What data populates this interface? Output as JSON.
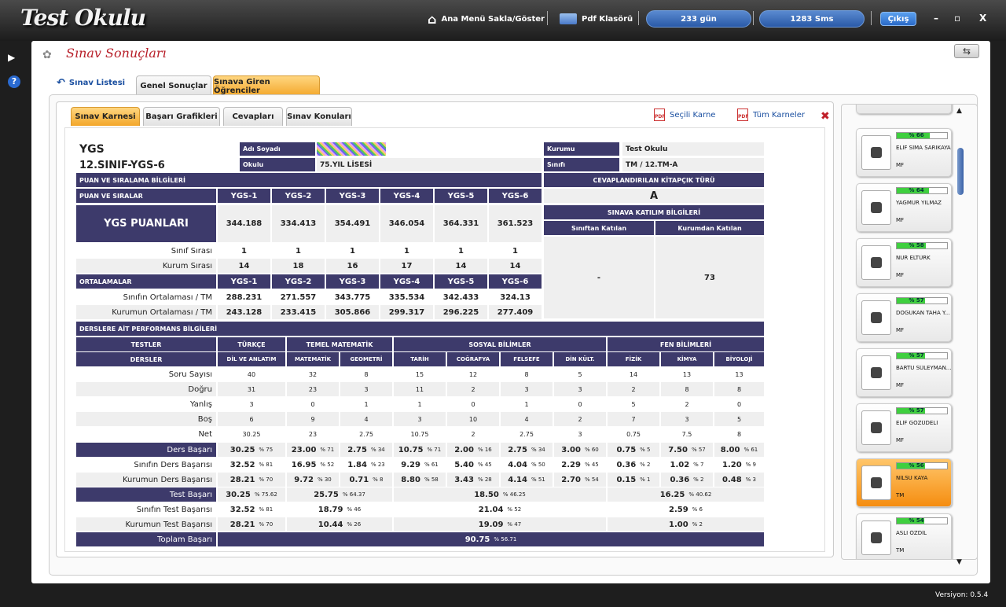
{
  "app": {
    "title": "Test Okulu",
    "menu_toggle": "Ana Menü Sakla/Göster",
    "pdf_folder": "Pdf Klasörü",
    "days": "233 gün",
    "sms": "1283 Sms",
    "logout": "Çıkış",
    "minimize": "–",
    "maximize": "▫",
    "close": "X",
    "version": "Versiyon: 0.5.4"
  },
  "page": {
    "title": "Sınav Sonuçları",
    "back": "Sınav Listesi",
    "tabs": [
      "Genel Sonuçlar",
      "Sınava Giren Öğrenciler"
    ],
    "subtabs": [
      "Sınav Karnesi",
      "Başarı Grafikleri",
      "Cevapları",
      "Sınav Konuları"
    ],
    "pdf_selected": "Seçili Karne",
    "pdf_all": "Tüm Karneler"
  },
  "report": {
    "exam": "YGS",
    "exam_code": "12.SINIF-YGS-6",
    "l_name": "Adı Soyadı",
    "l_school": "Okulu",
    "school": "75.YIL LİSESİ",
    "l_inst": "Kurumu",
    "inst": "Test Okulu",
    "l_class": "Sınıfı",
    "cls": "TM / 12.TM-A",
    "sec_scores": "PUAN VE SIRALAMA BİLGİLERİ",
    "sec_booklet": "CEVAPLANDIRILAN KİTAPÇIK TÜRÜ",
    "booklet": "A",
    "l_scores": "PUAN VE SIRALAR",
    "ygs_cols": [
      "YGS-1",
      "YGS-2",
      "YGS-3",
      "YGS-4",
      "YGS-5",
      "YGS-6"
    ],
    "l_ygs_points": "YGS PUANLARI",
    "points": [
      "344.188",
      "334.413",
      "354.491",
      "346.054",
      "364.331",
      "361.523"
    ],
    "sec_participation": "SINAVA KATILIM BİLGİLERİ",
    "l_class_part": "Sınıftan Katılan",
    "l_inst_part": "Kurumdan Katılan",
    "class_part": "-",
    "inst_part": "73",
    "l_class_rank": "Sınıf Sırası",
    "class_rank": [
      "1",
      "1",
      "1",
      "1",
      "1",
      "1"
    ],
    "l_inst_rank": "Kurum Sırası",
    "inst_rank": [
      "14",
      "18",
      "16",
      "17",
      "14",
      "14"
    ],
    "l_averages": "ORTALAMALAR",
    "l_class_avg": "Sınıfın Ortalaması / TM",
    "class_avg": [
      "288.231",
      "271.557",
      "343.775",
      "335.534",
      "342.433",
      "324.13"
    ],
    "l_inst_avg": "Kurumun Ortalaması / TM",
    "inst_avg": [
      "243.128",
      "233.415",
      "305.866",
      "299.317",
      "296.225",
      "277.409"
    ],
    "sec_perf": "DERSLERE AİT PERFORMANS BİLGİLERİ",
    "l_tests": "TESTLER",
    "tests": [
      "TÜRKÇE",
      "TEMEL MATEMATİK",
      "SOSYAL BİLİMLER",
      "FEN BİLİMLERİ"
    ],
    "l_lessons": "DERSLER",
    "lessons": [
      "DİL VE ANLATIM",
      "MATEMATİK",
      "GEOMETRİ",
      "TARİH",
      "COĞRAFYA",
      "FELSEFE",
      "DİN KÜLT.",
      "FİZİK",
      "KİMYA",
      "BİYOLOJİ"
    ],
    "rows": [
      {
        "label": "Soru Sayısı",
        "vals": [
          "40",
          "32",
          "8",
          "15",
          "12",
          "8",
          "5",
          "14",
          "13",
          "13"
        ]
      },
      {
        "label": "Doğru",
        "vals": [
          "31",
          "23",
          "3",
          "11",
          "2",
          "3",
          "3",
          "2",
          "8",
          "8"
        ]
      },
      {
        "label": "Yanlış",
        "vals": [
          "3",
          "0",
          "1",
          "1",
          "0",
          "1",
          "0",
          "5",
          "2",
          "0"
        ]
      },
      {
        "label": "Boş",
        "vals": [
          "6",
          "9",
          "4",
          "3",
          "10",
          "4",
          "2",
          "7",
          "3",
          "5"
        ]
      },
      {
        "label": "Net",
        "vals": [
          "30.25",
          "23",
          "2.75",
          "10.75",
          "2",
          "2.75",
          "3",
          "0.75",
          "7.5",
          "8"
        ]
      }
    ],
    "l_lesson_success": "Ders Başarı",
    "lesson_success": [
      [
        "30.25",
        "% 75"
      ],
      [
        "23.00",
        "% 71"
      ],
      [
        "2.75",
        "% 34"
      ],
      [
        "10.75",
        "% 71"
      ],
      [
        "2.00",
        "% 16"
      ],
      [
        "2.75",
        "% 34"
      ],
      [
        "3.00",
        "% 60"
      ],
      [
        "0.75",
        "% 5"
      ],
      [
        "7.50",
        "% 57"
      ],
      [
        "8.00",
        "% 61"
      ]
    ],
    "l_class_lesson": "Sınıfın Ders Başarısı",
    "class_lesson": [
      [
        "32.52",
        "% 81"
      ],
      [
        "16.95",
        "% 52"
      ],
      [
        "1.84",
        "% 23"
      ],
      [
        "9.29",
        "% 61"
      ],
      [
        "5.40",
        "% 45"
      ],
      [
        "4.04",
        "% 50"
      ],
      [
        "2.29",
        "% 45"
      ],
      [
        "0.36",
        "% 2"
      ],
      [
        "1.02",
        "% 7"
      ],
      [
        "1.20",
        "% 9"
      ]
    ],
    "l_inst_lesson": "Kurumun Ders Başarısı",
    "inst_lesson": [
      [
        "28.21",
        "% 70"
      ],
      [
        "9.72",
        "% 30"
      ],
      [
        "0.71",
        "% 8"
      ],
      [
        "8.80",
        "% 58"
      ],
      [
        "3.43",
        "% 28"
      ],
      [
        "4.14",
        "% 51"
      ],
      [
        "2.70",
        "% 54"
      ],
      [
        "0.15",
        "% 1"
      ],
      [
        "0.36",
        "% 2"
      ],
      [
        "0.48",
        "% 3"
      ]
    ],
    "l_test_success": "Test Başarı",
    "test_success": [
      [
        "30.25",
        "% 75.62"
      ],
      [
        "25.75",
        "% 64.37"
      ],
      [
        "18.50",
        "% 46.25"
      ],
      [
        "16.25",
        "% 40.62"
      ]
    ],
    "l_class_test": "Sınıfın Test Başarısı",
    "class_test": [
      [
        "32.52",
        "% 81"
      ],
      [
        "18.79",
        "% 46"
      ],
      [
        "21.04",
        "% 52"
      ],
      [
        "2.59",
        "% 6"
      ]
    ],
    "l_inst_test": "Kurumun Test Başarısı",
    "inst_test": [
      [
        "28.21",
        "% 70"
      ],
      [
        "10.44",
        "% 26"
      ],
      [
        "19.09",
        "% 47"
      ],
      [
        "1.00",
        "% 2"
      ]
    ],
    "l_total": "Toplam Başarı",
    "total": [
      "90.75",
      "% 56.71"
    ]
  },
  "students": [
    {
      "pct": "% 66",
      "fill": 0.66,
      "name": "ELİF SİMA SARIKAYA",
      "group": "MF",
      "selected": false
    },
    {
      "pct": "% 64",
      "fill": 0.64,
      "name": "YAĞMUR YILMAZ",
      "group": "MF",
      "selected": false
    },
    {
      "pct": "% 58",
      "fill": 0.58,
      "name": "NUR ELTÜRK",
      "group": "MF",
      "selected": false
    },
    {
      "pct": "% 57",
      "fill": 0.57,
      "name": "DOĞUKAN TAHA Y...",
      "group": "MF",
      "selected": false
    },
    {
      "pct": "% 57",
      "fill": 0.57,
      "name": "BARTU SÜLEYMAN...",
      "group": "MF",
      "selected": false
    },
    {
      "pct": "% 57",
      "fill": 0.57,
      "name": "ELİF GÖZÜDELİ",
      "group": "MF",
      "selected": false
    },
    {
      "pct": "% 56",
      "fill": 0.56,
      "name": "NİLSU KAYA",
      "group": "TM",
      "selected": true
    },
    {
      "pct": "% 54",
      "fill": 0.54,
      "name": "ASLI ÖZDİL",
      "group": "TM",
      "selected": false
    }
  ],
  "colors": {
    "header": "#3d3a6b",
    "tab_active": "#f3a72a",
    "progress": "#3fcf3f"
  }
}
